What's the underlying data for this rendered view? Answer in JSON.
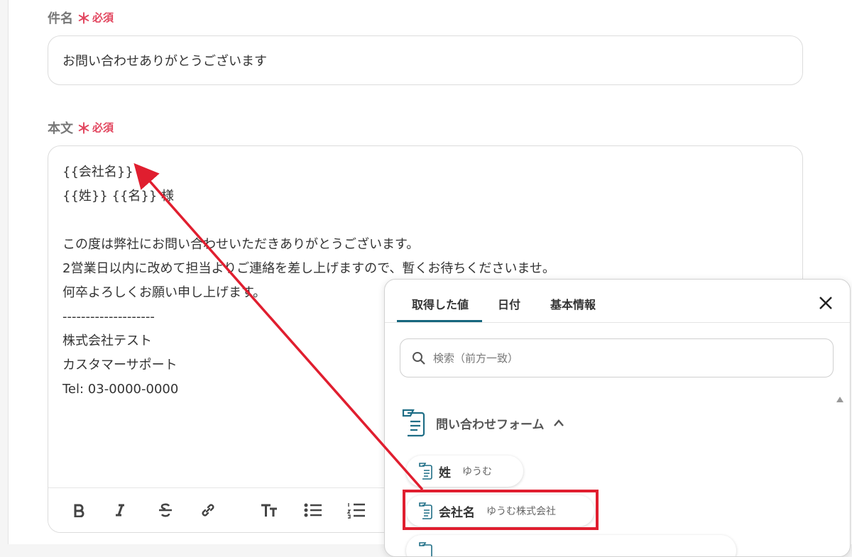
{
  "subject": {
    "label": "件名",
    "required_mark": "＊",
    "required_text": "必須",
    "value": "お問い合わせありがとうございます"
  },
  "body": {
    "label": "本文",
    "required_mark": "＊",
    "required_text": "必須",
    "lines": [
      "{{会社名}}",
      "{{姓}} {{名}} 様",
      "",
      "この度は弊社にお問い合わせいただきありがとうございます。",
      "2営業日以内に改めて担当よりご連絡を差し上げますので、暫くお待ちくださいませ。",
      "何卒よろしくお願い申し上げます。",
      "--------------------",
      "株式会社テスト",
      "カスタマーサポート",
      "Tel: 03-0000-0000"
    ]
  },
  "toolbar": {
    "buttons": [
      "bold-icon",
      "italic-icon",
      "strikethrough-icon",
      "link-icon",
      "text-size-icon",
      "bulleted-list-icon",
      "numbered-list-icon"
    ]
  },
  "popup": {
    "tabs": [
      "取得した値",
      "日付",
      "基本情報"
    ],
    "active_tab": 0,
    "close_icon": "close-icon",
    "search_placeholder": "検索（前方一致）",
    "section_title": "問い合わせフォーム",
    "items": [
      {
        "label": "姓",
        "value": "ゆうむ"
      },
      {
        "label": "会社名",
        "value": "ゆうむ株式会社"
      }
    ]
  },
  "colors": {
    "accent": "#16667e",
    "required": "#e2455e",
    "annotation_red": "#e01e2f"
  }
}
